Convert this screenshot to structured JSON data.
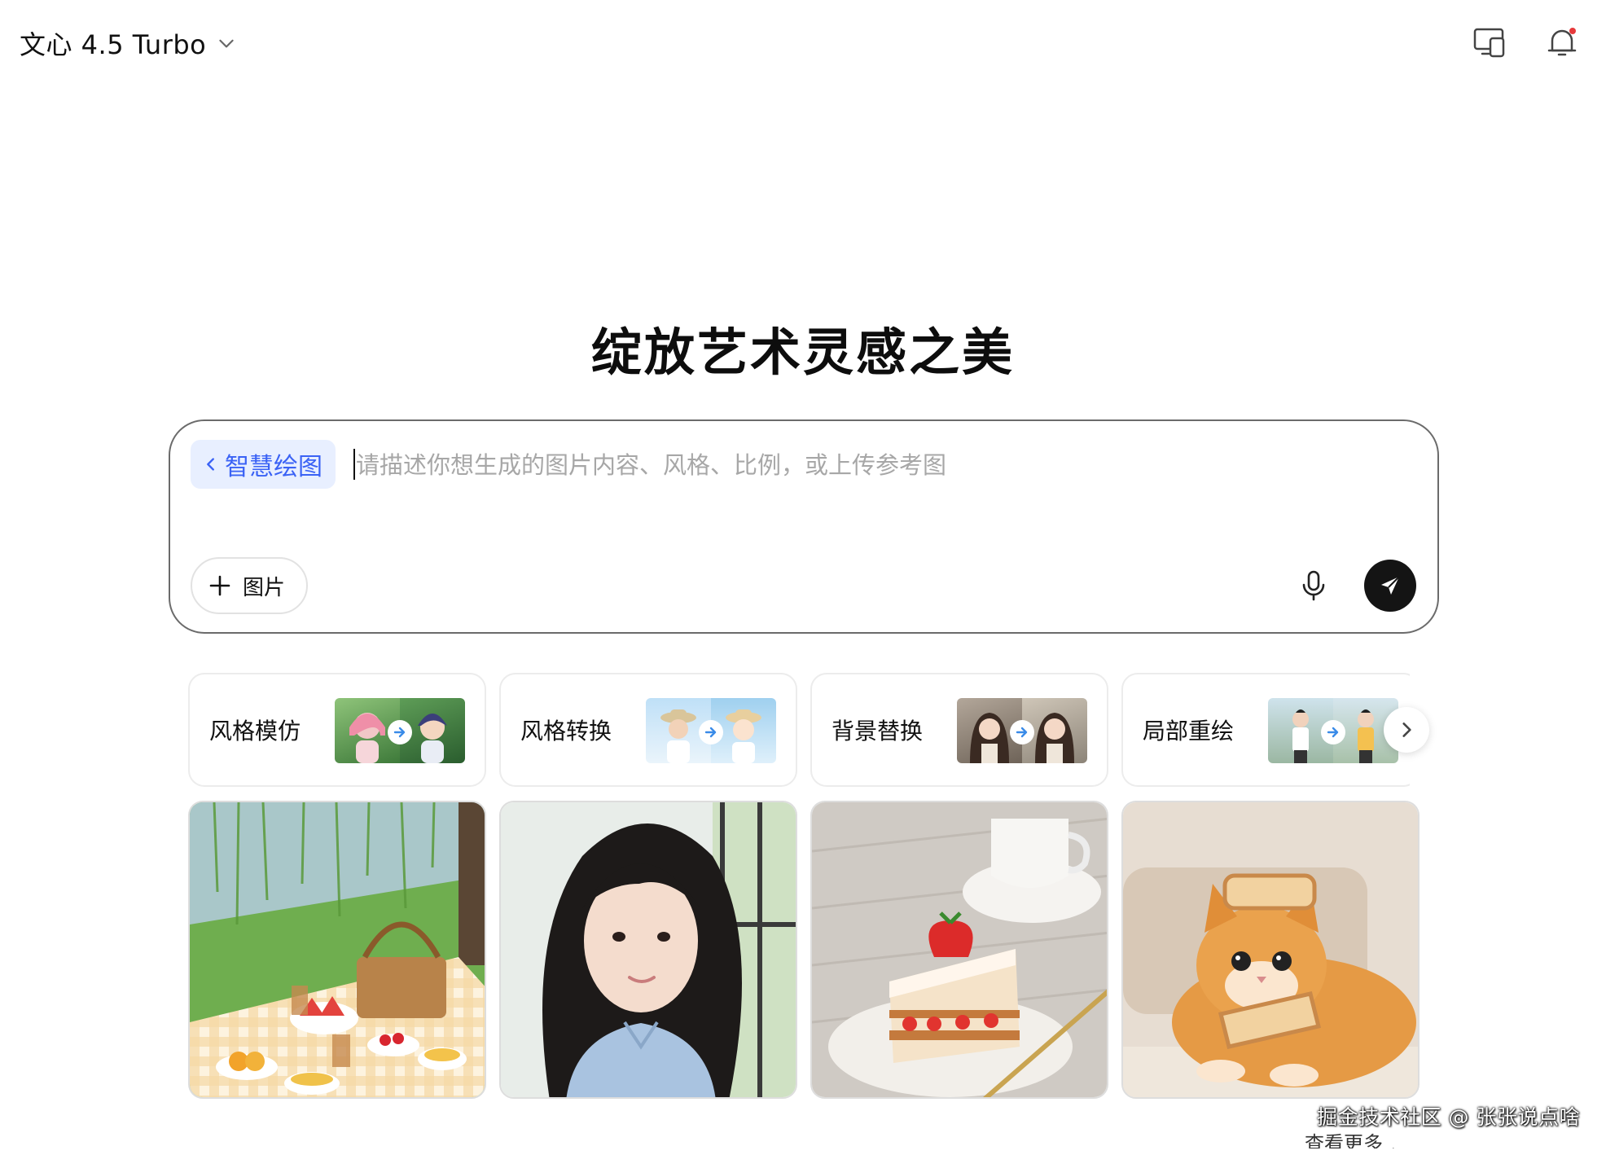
{
  "header": {
    "model_name": "文心 4.5 Turbo",
    "icons": [
      "chevron-down-icon",
      "devices-icon",
      "bell-icon"
    ],
    "notification_dot_color": "#e6393b"
  },
  "headline": "绽放艺术灵感之美",
  "prompt": {
    "mode_label": "智慧绘图",
    "placeholder": "请描述你想生成的图片内容、风格、比例，或上传参考图",
    "add_image_label": "图片",
    "accent_color": "#3a62f5"
  },
  "features": [
    {
      "label": "风格模仿"
    },
    {
      "label": "风格转换"
    },
    {
      "label": "背景替换"
    },
    {
      "label": "局部重绘"
    }
  ],
  "gallery": [
    {
      "icon": "picnic-image"
    },
    {
      "icon": "portrait-image"
    },
    {
      "icon": "strawberry-cake-image"
    },
    {
      "icon": "cat-with-toast-image"
    }
  ],
  "footer": {
    "watermark": "掘金技术社区 @ 张张说点啥",
    "see_more": "查看更多"
  }
}
